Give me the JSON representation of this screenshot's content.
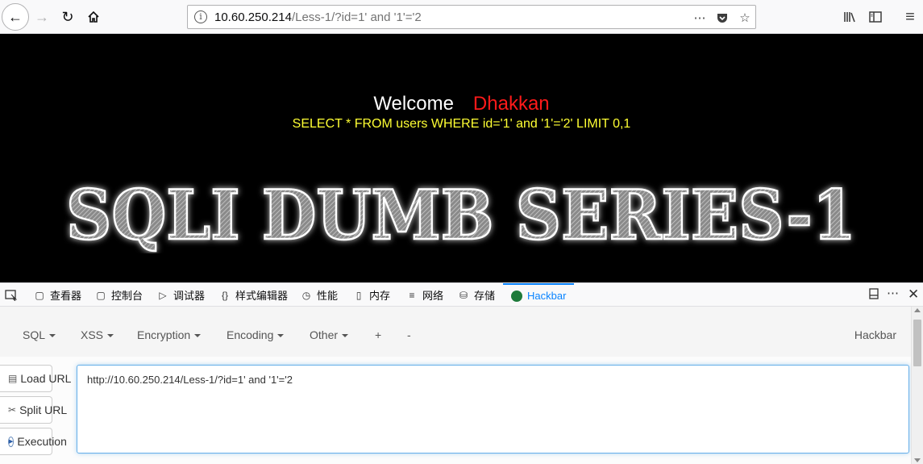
{
  "browser": {
    "url_host": "10.60.250.214",
    "url_path": "/Less-1/?id=1' and '1'='2"
  },
  "page": {
    "welcome_label": "Welcome",
    "username": "Dhakkan",
    "query": "SELECT * FROM users WHERE id='1' and '1'='2' LIMIT 0,1",
    "banner": "SQLI DUMB SERIES-1"
  },
  "devtools": {
    "tabs": [
      {
        "label": "查看器",
        "icon": "inspector-icon"
      },
      {
        "label": "控制台",
        "icon": "console-icon"
      },
      {
        "label": "调试器",
        "icon": "debugger-icon"
      },
      {
        "label": "样式编辑器",
        "icon": "style-editor-icon"
      },
      {
        "label": "性能",
        "icon": "performance-icon"
      },
      {
        "label": "内存",
        "icon": "memory-icon"
      },
      {
        "label": "网络",
        "icon": "network-icon"
      },
      {
        "label": "存储",
        "icon": "storage-icon"
      },
      {
        "label": "Hackbar",
        "icon": "hackbar-icon",
        "active": true
      }
    ]
  },
  "hackbar": {
    "menu": {
      "sql": "SQL",
      "xss": "XSS",
      "encryption": "Encryption",
      "encoding": "Encoding",
      "other": "Other",
      "plus": "+",
      "minus": "-"
    },
    "brand": "Hackbar",
    "buttons": {
      "load": "Load URL",
      "split": "Split URL",
      "execute": "Execution"
    },
    "url_value": "http://10.60.250.214/Less-1/?id=1' and '1'='2"
  }
}
